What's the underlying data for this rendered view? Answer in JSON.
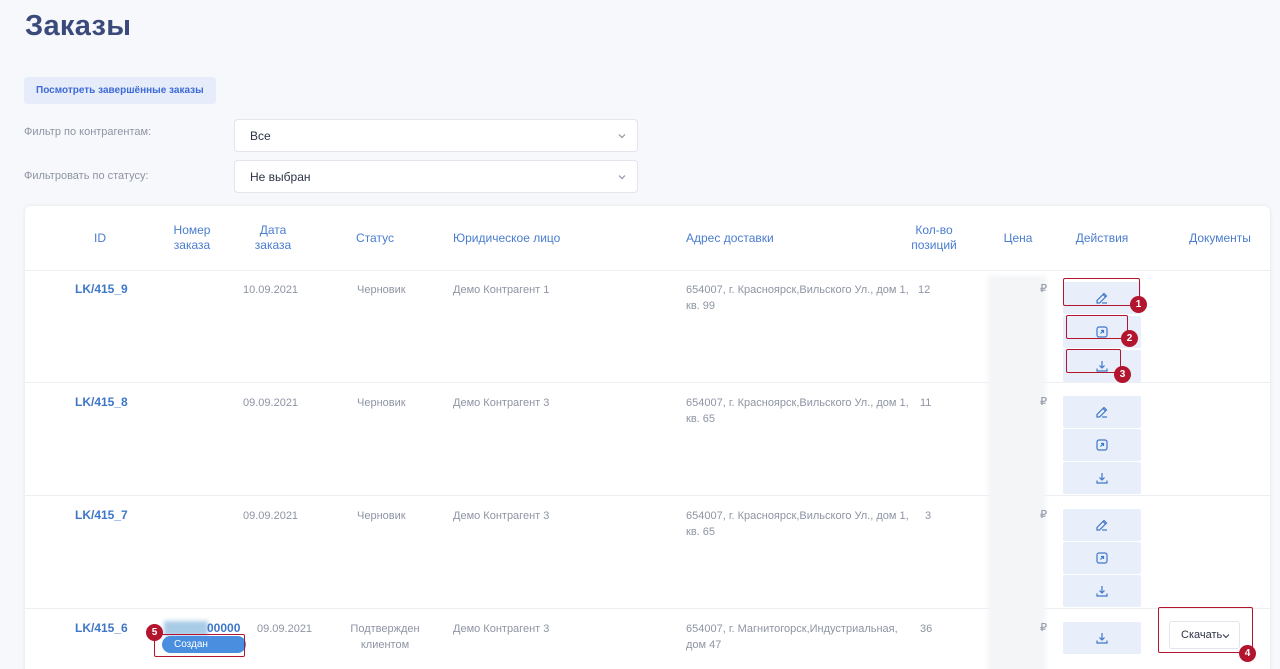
{
  "page": {
    "title": "Заказы"
  },
  "toolbar": {
    "completed_orders_label": "Посмотреть завершённые заказы"
  },
  "filters": {
    "counterparty": {
      "label": "Фильтр по контрагентам:",
      "value": "Все"
    },
    "status": {
      "label": "Фильтровать по статусу:",
      "value": "Не выбран"
    }
  },
  "table": {
    "headers": {
      "id": "ID",
      "order_number": "Номер заказа",
      "date": "Дата заказа",
      "status": "Статус",
      "legal_entity": "Юридическое лицо",
      "address": "Адрес доставки",
      "quantity": "Кол-во позиций",
      "price": "Цена",
      "actions": "Действия",
      "documents": "Документы"
    },
    "currency": "₽",
    "rows": [
      {
        "id": "LK/415_9",
        "order_number": "",
        "order_status": "",
        "date": "10.09.2021",
        "status": "Черновик",
        "legal_entity": "Демо Контрагент 1",
        "address": "654007, г. Красноярск,Вильского Ул., дом 1, кв. 99",
        "quantity": "12"
      },
      {
        "id": "LK/415_8",
        "order_number": "",
        "order_status": "",
        "date": "09.09.2021",
        "status": "Черновик",
        "legal_entity": "Демо Контрагент 3",
        "address": "654007, г. Красноярск,Вильского Ул., дом 1, кв. 65",
        "quantity": "11"
      },
      {
        "id": "LK/415_7",
        "order_number": "",
        "order_status": "",
        "date": "09.09.2021",
        "status": "Черновик",
        "legal_entity": "Демо Контрагент 3",
        "address": "654007, г. Красноярск,Вильского Ул., дом 1, кв. 65",
        "quantity": "3"
      },
      {
        "id": "LK/415_6",
        "order_number": "00000",
        "order_status": "Создан",
        "date": "09.09.2021",
        "status": "Подтвержден клиентом",
        "legal_entity": "Демо Контрагент 3",
        "address": "654007, г. Магнитогорск,Индустриальная, дом 47",
        "quantity": "36",
        "download_label": "Скачать"
      }
    ]
  },
  "markers": [
    "1",
    "2",
    "3",
    "4",
    "5"
  ],
  "colors": {
    "accent": "#3f77c8",
    "highlight": "#b3152f",
    "button_bg": "#e9effa",
    "pill": "#4a8ee0"
  }
}
